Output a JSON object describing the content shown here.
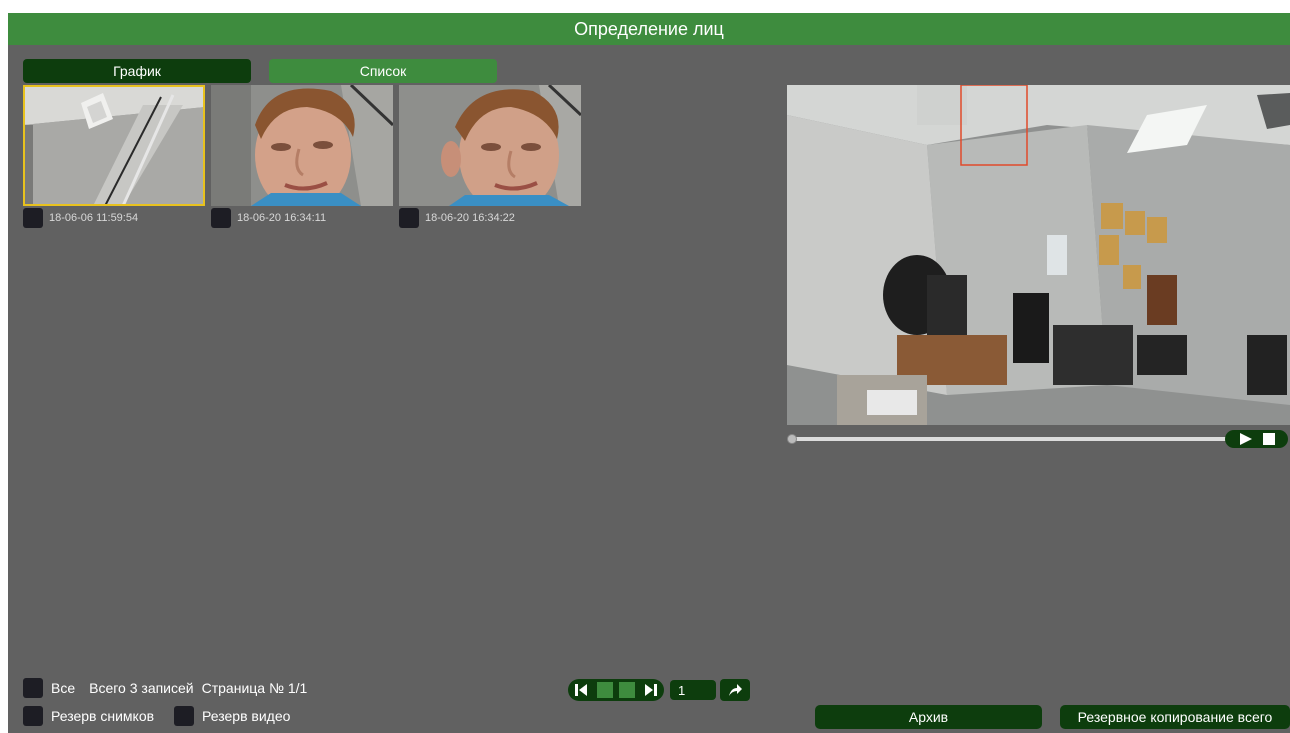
{
  "window": {
    "title": "Определение лиц"
  },
  "tabs": [
    {
      "label": "График",
      "active": true
    },
    {
      "label": "Список",
      "active": false
    }
  ],
  "records": [
    {
      "timestamp": "18-06-06 11:59:54",
      "kind": "wall",
      "selected": true
    },
    {
      "timestamp": "18-06-20 16:34:11",
      "kind": "face",
      "selected": false
    },
    {
      "timestamp": "18-06-20 16:34:22",
      "kind": "face",
      "selected": false
    }
  ],
  "footer": {
    "all_label": "Все",
    "total_label": "Всего 3 записей",
    "page_label": "Страница № 1/1",
    "snap_backup_label": "Резерв снимков",
    "video_backup_label": "Резерв видео"
  },
  "pager": {
    "page_value": "1"
  },
  "buttons": {
    "archive": "Архив",
    "backup_all": "Резервное копирование всего"
  },
  "playback": {
    "position": 0
  },
  "colors": {
    "title_bar": "#3e8c3e",
    "dark_button": "#0d3d0d",
    "background": "#616161",
    "selection": "#e8c21e",
    "detect_box": "#e04a2a"
  },
  "icons": [
    "first-page-icon",
    "prev-page-icon",
    "next-page-icon",
    "last-page-icon",
    "go-arrow-icon",
    "play-icon",
    "stop-icon"
  ]
}
